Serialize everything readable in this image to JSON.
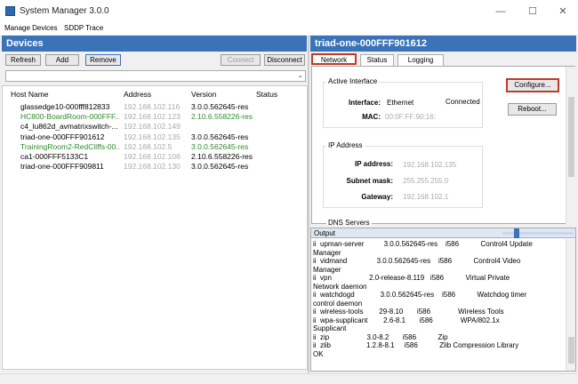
{
  "window": {
    "title": "System Manager 3.0.0",
    "controls": [
      "—",
      "☐",
      "✕"
    ]
  },
  "menu": {
    "items": [
      "Manage Devices",
      "SDDP Trace"
    ]
  },
  "devices": {
    "header": "Devices",
    "buttons": {
      "refresh": "Refresh",
      "add": "Add",
      "remove": "Remove",
      "connect": "Connect",
      "disconnect": "Disconnect"
    },
    "dropdown_arrow": "⌄",
    "columns": [
      "Host Name",
      "Address",
      "Version",
      "Status"
    ],
    "rows": [
      {
        "host": "glassedge10-000fff812833",
        "address": "192.168.102.116",
        "version": "3.0.0.562645-res",
        "status": "",
        "color": "normal"
      },
      {
        "host": "HC800-BoardRoom-000FFF...",
        "address": "192.168.102.123",
        "version": "2.10.6.558226-res",
        "status": "",
        "color": "green"
      },
      {
        "host": "c4_lu862d_avmatrixswitch-...",
        "address": "192.168.102.149",
        "version": "",
        "status": "",
        "color": "normal"
      },
      {
        "host": "triad-one-000FFF901612",
        "address": "192.168.102.135",
        "version": "3.0.0.562645-res",
        "status": "",
        "color": "normal"
      },
      {
        "host": "TrainingRoom2-RedCliffs-00...",
        "address": "192.168.102.5",
        "version": "3.0.0.562645-res",
        "status": "",
        "color": "green"
      },
      {
        "host": "ca1-000FFF5133C1",
        "address": "192.168.102.106",
        "version": "2.10.6.558226-res",
        "status": "",
        "color": "normal"
      },
      {
        "host": "triad-one-000FFF909811",
        "address": "192.168.102.130",
        "version": "3.0.0.562645-res",
        "status": "",
        "color": "normal"
      }
    ]
  },
  "detail": {
    "header": "triad-one-000FFF901612",
    "tabs": [
      "Network",
      "Status",
      "Logging"
    ],
    "active_interface": {
      "title": "Active Interface",
      "interface_label": "Interface:",
      "interface_value": "Ethernet",
      "interface_status": "Connected",
      "mac_label": "MAC:",
      "mac_value": "00:0F:FF:90:16:"
    },
    "ip_address": {
      "title": "IP Address",
      "ip_label": "IP address:",
      "ip_value": "192.168.102.135",
      "subnet_label": "Subnet mask:",
      "subnet_value": "255.255.255.0",
      "gateway_label": "Gateway:",
      "gateway_value": "192.168.102.1"
    },
    "dns_title": "DNS Servers",
    "buttons": {
      "configure": "Configure...",
      "reboot": "Reboot..."
    }
  },
  "output": {
    "header": "Output",
    "lines": [
      "ii  upman-server          3.0.0.562645-res    i586           Control4 Update",
      "Manager",
      "ii  vidmand               3.0.0.562645-res    i586           Control4 Video",
      "Manager",
      "ii  vpn                   2.0-release-8.119   i586           Virtual Private",
      "Network daemon",
      "ii  watchdogd             3.0.0.562645-res    i586           Watchdog timer",
      "control daemon",
      "ii  wireless-tools        29-8.10       i586              Wireless Tools",
      "ii  wpa-supplicant        2.6-8.1       i586              WPA/802.1x",
      "Supplicant",
      "ii  zip                   3.0-8.2       i586           Zip",
      "ii  zlib                  1.2.8-8.1     i586           Zlib Compression Library",
      "OK"
    ]
  }
}
